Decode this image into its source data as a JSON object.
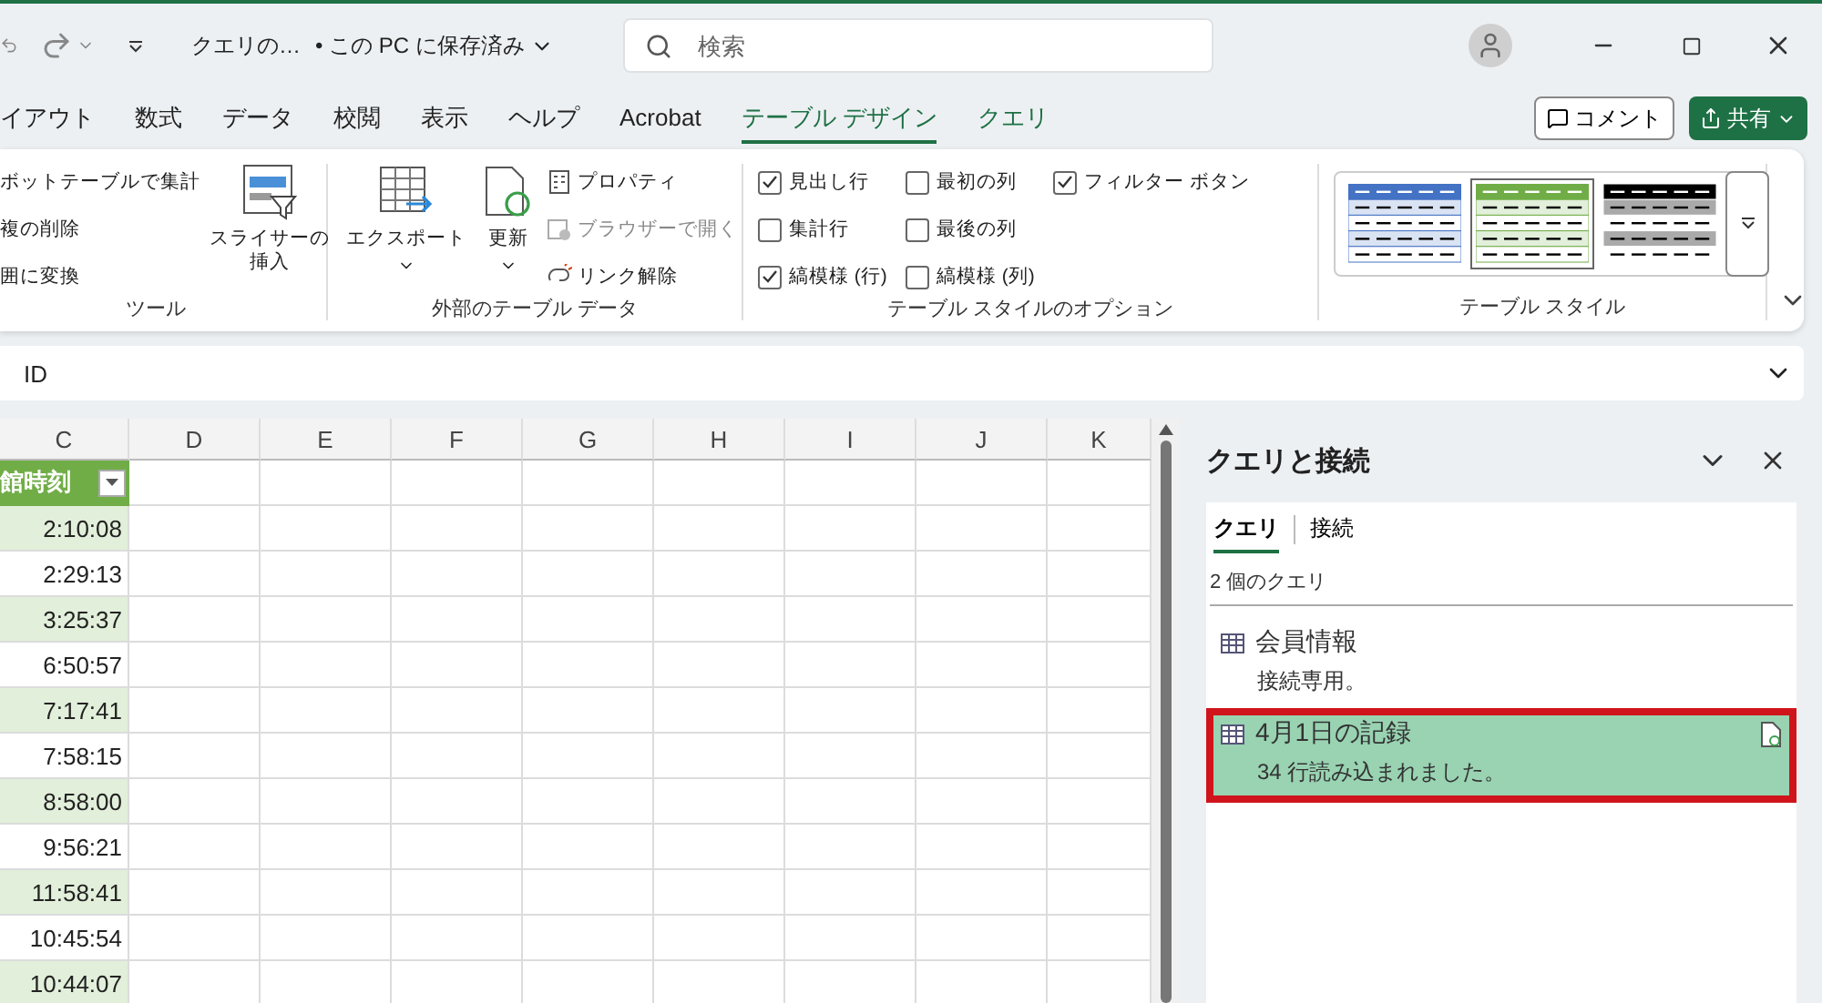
{
  "title_bar": {
    "file_name": "クエリの…",
    "save_status": "• この PC に保存済み",
    "search": {
      "placeholder": "検索"
    }
  },
  "menu_tabs": [
    {
      "label": "イアウト",
      "selected": false,
      "contextual": false
    },
    {
      "label": "数式",
      "selected": false,
      "contextual": false
    },
    {
      "label": "データ",
      "selected": false,
      "contextual": false
    },
    {
      "label": "校閲",
      "selected": false,
      "contextual": false
    },
    {
      "label": "表示",
      "selected": false,
      "contextual": false
    },
    {
      "label": "ヘルプ",
      "selected": false,
      "contextual": false
    },
    {
      "label": "Acrobat",
      "selected": false,
      "contextual": false
    },
    {
      "label": "テーブル デザイン",
      "selected": true,
      "contextual": true
    },
    {
      "label": "クエリ",
      "selected": false,
      "contextual": true
    }
  ],
  "comment_button": "コメント",
  "share_button": "共有",
  "ribbon": {
    "tools": {
      "label": "ツール",
      "small_buttons": [
        "ボットテーブルで集計",
        "複の削除",
        "囲に変換"
      ],
      "slicer_button": "スライサーの挿入"
    },
    "external": {
      "label": "外部のテーブル データ",
      "export_button": "エクスポート",
      "refresh_button": "更新",
      "small_buttons": [
        {
          "label": "プロパティ",
          "disabled": false,
          "kind": "properties"
        },
        {
          "label": "ブラウザーで開く",
          "disabled": true,
          "kind": "browser"
        },
        {
          "label": "リンク解除",
          "disabled": false,
          "kind": "unlink"
        }
      ]
    },
    "options": {
      "label": "テーブル スタイルのオプション",
      "checkboxes": [
        {
          "label": "見出し行",
          "checked": true
        },
        {
          "label": "集計行",
          "checked": false
        },
        {
          "label": "縞模様 (行)",
          "checked": true
        },
        {
          "label": "最初の列",
          "checked": false
        },
        {
          "label": "最後の列",
          "checked": false
        },
        {
          "label": "縞模様 (列)",
          "checked": false
        },
        {
          "label": "フィルター ボタン",
          "checked": true
        }
      ]
    },
    "styles": {
      "label": "テーブル スタイル",
      "swatches": [
        {
          "color": "#4472c4",
          "selected": false
        },
        {
          "color": "#70ad47",
          "selected": true
        },
        {
          "color": "#000000",
          "selected": false
        }
      ]
    }
  },
  "formula_bar": {
    "value": "ID"
  },
  "sheet": {
    "columns": [
      "C",
      "D",
      "E",
      "F",
      "G",
      "H",
      "I",
      "J",
      "K"
    ],
    "header_cell": "館時刻",
    "values": [
      "2:10:08",
      "2:29:13",
      "3:25:37",
      "6:50:57",
      "7:17:41",
      "7:58:15",
      "8:58:00",
      "9:56:21",
      "11:58:41",
      "10:45:54",
      "10:44:07"
    ]
  },
  "queries_panel": {
    "title": "クエリと接続",
    "tabs": [
      {
        "label": "クエリ",
        "selected": true
      },
      {
        "label": "接続",
        "selected": false
      }
    ],
    "count": "2 個のクエリ",
    "items": [
      {
        "name": "会員情報",
        "status": "接続専用。",
        "selected": false,
        "highlighted": false
      },
      {
        "name": "4月1日の記録",
        "status": "34 行読み込まれました。",
        "selected": true,
        "highlighted": true
      }
    ]
  }
}
